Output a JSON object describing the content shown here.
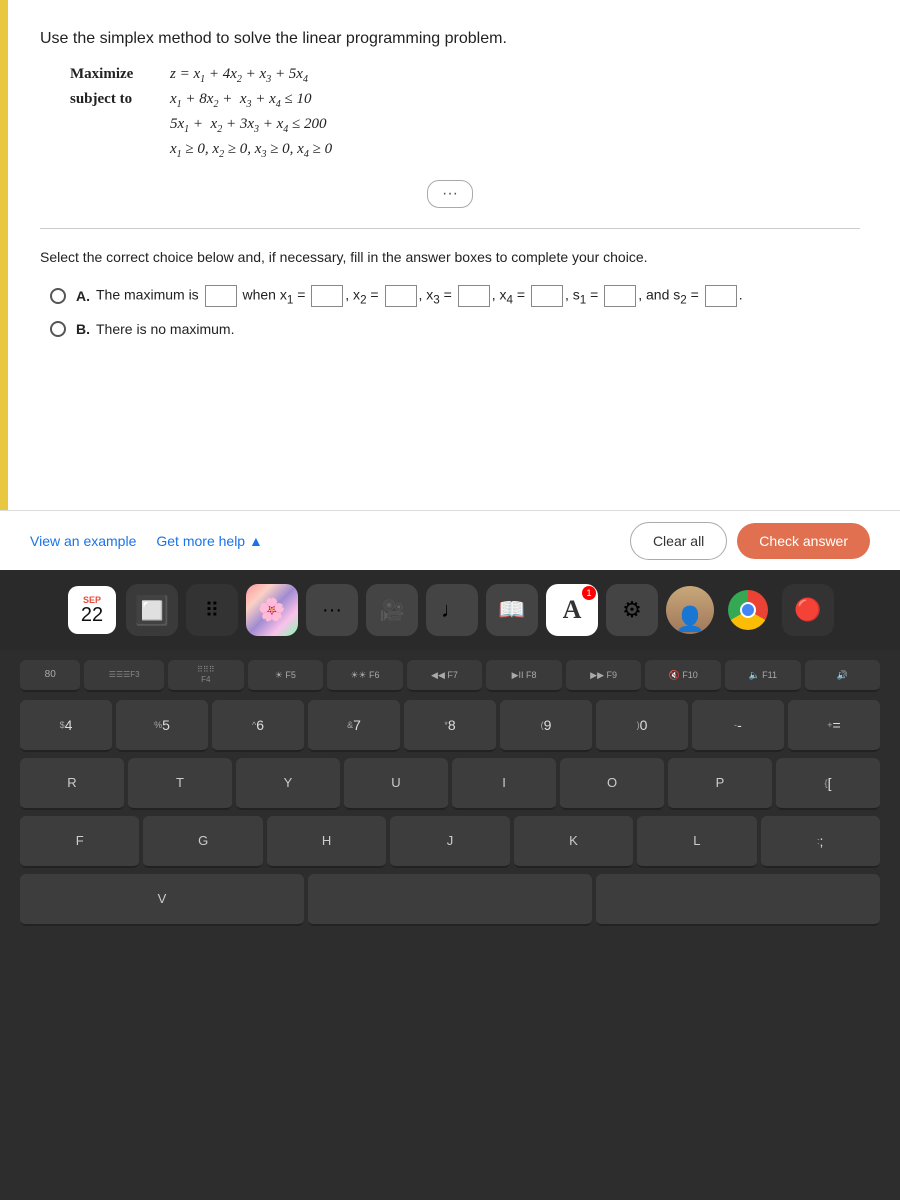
{
  "problem": {
    "instruction": "Use the simplex method to solve the linear programming problem.",
    "maximize_label": "Maximize",
    "maximize_expr": "z = x₁ + 4x₂ + x₃ + 5x₄",
    "subject_label": "subject to",
    "constraint1": "x₁ + 8x₂ + x₃ + x₄ ≤ 10",
    "constraint2": "5x₁ + x₂ + 3x₃ + x₄ ≤ 200",
    "constraint3": "x₁ ≥ 0, x₂ ≥ 0, x₃ ≥ 0, x₄ ≥ 0"
  },
  "select_instruction": "Select the correct choice below and, if necessary, fill in the answer boxes to complete your choice.",
  "choices": {
    "A_label": "A.",
    "A_text": "The maximum is",
    "A_when": "when x₁ =",
    "A_vars": ", x₂ =  , x₃ =  , x₄ =  , s₁ =  , and s₂ =  .",
    "B_label": "B.",
    "B_text": "There is no maximum."
  },
  "footer": {
    "view_example": "View an example",
    "get_more_help": "Get more help ▲",
    "clear_all": "Clear all",
    "check_answer": "Check answer"
  },
  "dock": {
    "month": "SEP",
    "day": "22"
  },
  "keyboard": {
    "fn_row": [
      "80\nF3",
      "000\n000 F4",
      "F5",
      "F6",
      "◀◀\nF7",
      "▶II\nF8",
      "▶▶\nF9",
      "◀\nF10",
      "♪)\nF11",
      "♪))\n"
    ],
    "number_row": [
      "$\n4",
      "%\n5",
      "^\n6",
      "&\n7",
      "*\n8",
      "(\n9",
      ")\n0",
      "-\n-",
      "+\n="
    ],
    "row_qwerty1": [
      "R",
      "T",
      "Y",
      "U",
      "I",
      "O",
      "P",
      "{",
      "["
    ],
    "row_qwerty2": [
      "F",
      "G",
      "H",
      "J",
      "K",
      "L",
      ":",
      ";"
    ]
  }
}
